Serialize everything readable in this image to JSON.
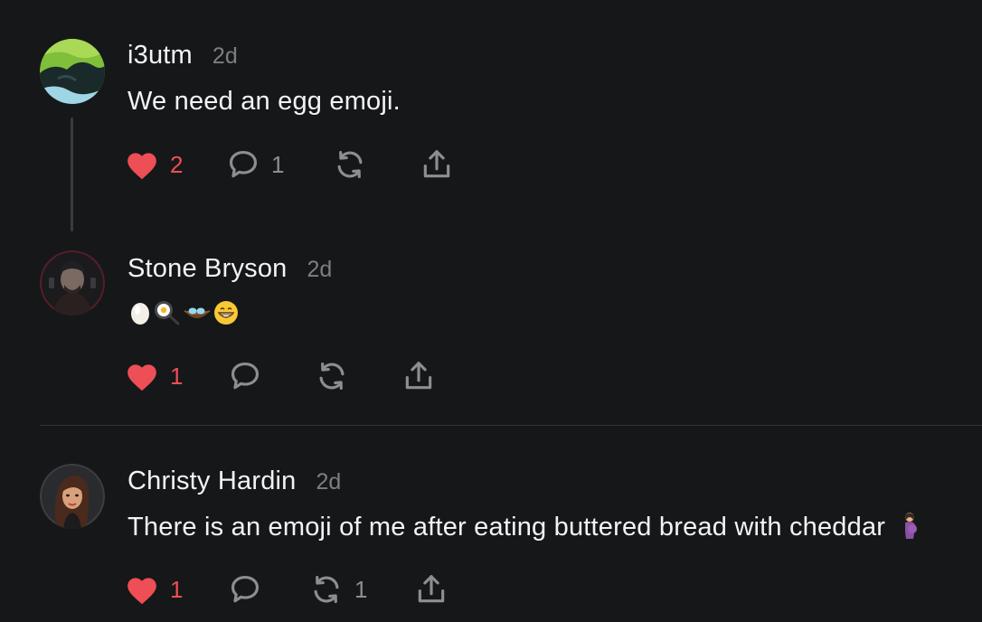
{
  "posts": [
    {
      "username": "i3utm",
      "timestamp": "2d",
      "text": "We need an egg emoji.",
      "likes": "2",
      "replies": "1",
      "reposts": "",
      "liked": true
    },
    {
      "username": "Stone Bryson",
      "timestamp": "2d",
      "text": "",
      "emojis": [
        "egg",
        "frying-pan-with-egg",
        "nest-with-eggs",
        "grinning-face"
      ],
      "likes": "1",
      "replies": "",
      "reposts": "",
      "liked": true
    },
    {
      "username": "Christy Hardin",
      "timestamp": "2d",
      "text": "There is an emoji of me after eating buttered bread with cheddar",
      "trailing_emoji": "pregnant-woman",
      "likes": "1",
      "replies": "",
      "reposts": "1",
      "liked": true
    }
  ],
  "colors": {
    "background": "#161719",
    "like_active": "#ee4e55",
    "icon_muted": "#8d8e92",
    "timestamp": "#7d7e82"
  }
}
